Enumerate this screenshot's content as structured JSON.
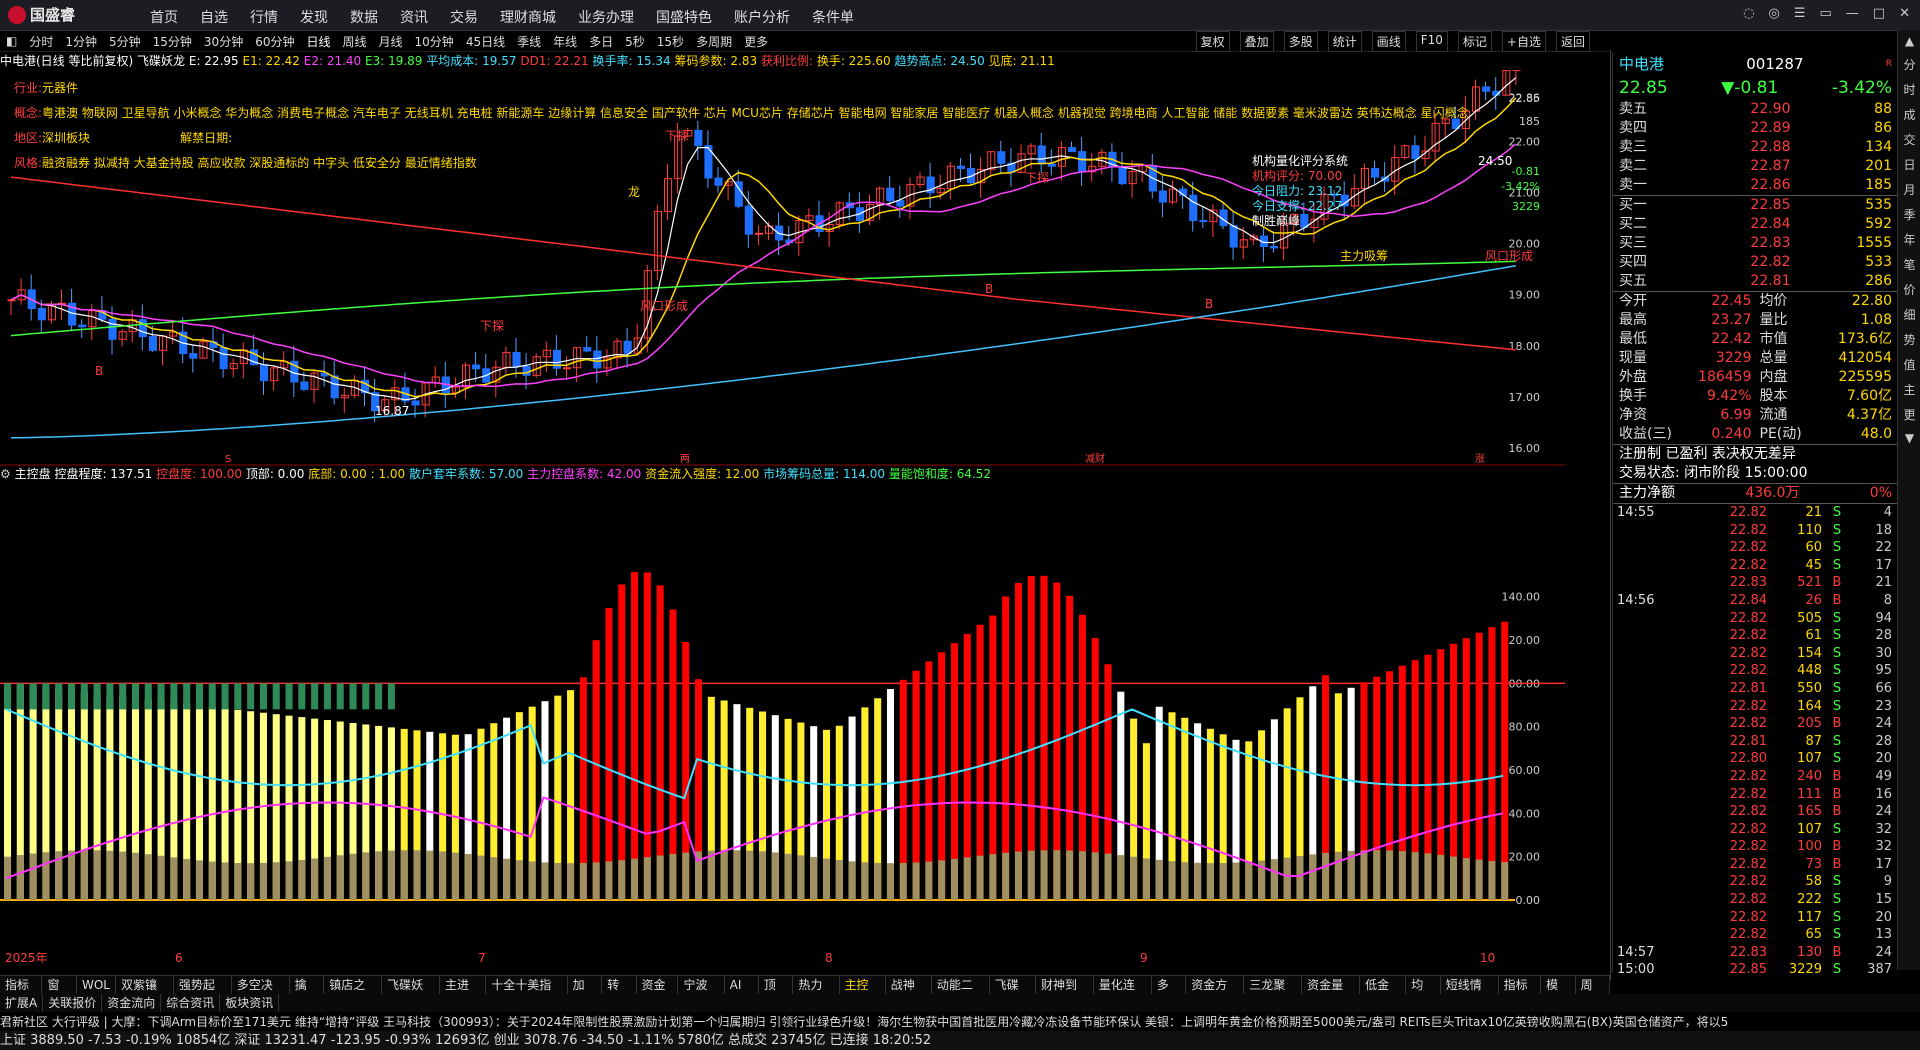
{
  "app": {
    "logo": "国盛睿",
    "menu": [
      "首页",
      "自选",
      "行情",
      "发现",
      "数据",
      "资讯",
      "交易",
      "理财商城",
      "业务办理",
      "国盛特色",
      "账户分析",
      "条件单"
    ],
    "window_buttons": [
      "□",
      "◎",
      "—",
      "□",
      "×"
    ]
  },
  "periods": {
    "items": [
      "分时",
      "1分钟",
      "5分钟",
      "15分钟",
      "30分钟",
      "60分钟",
      "日线",
      "周线",
      "月线",
      "10分钟",
      "45日线",
      "季线",
      "年线",
      "多日",
      "5秒",
      "15秒",
      "多周期",
      "更多"
    ],
    "active": "日线"
  },
  "tools": [
    "复权",
    "叠加",
    "多股",
    "统计",
    "画线",
    "F10",
    "标记",
    "+自选",
    "返回"
  ],
  "indicator_line": {
    "name": "中电港(日线 等比前复权)",
    "plugin": "飞碟妖龙",
    "e": "E: 22.95",
    "e1": "E1: 22.42",
    "e2": "E2: 21.40",
    "e3": "E3: 19.89",
    "avg": "平均成本: 19.57",
    "dd1": "DD1: 22.21",
    "turnover": "换手率: 15.34",
    "chip": "筹码参数: 2.83",
    "profit": "获利比例:",
    "hand": "换手: 225.60",
    "trend_high": "趋势高点: 24.50",
    "trend_low": "见底: 21.11"
  },
  "stock_info": {
    "industry_label": "行业:",
    "industry": "元器件",
    "concept_label": "概念:",
    "concepts": "粤港澳 物联网 卫星导航 小米概念 华为概念 消费电子概念 汽车电子 无线耳机 充电桩 新能源车 边缘计算 信息安全 国产软件 芯片 MCU芯片 存储芯片 智能电网 智能家居 智能医疗 机器人概念 机器视觉 跨境电商 人工智能 储能 数据要素 毫米波雷达 英伟达概念 星闪概念",
    "region_label": "地区:",
    "region": "深圳板块",
    "unlock_label": "解禁日期:",
    "style_label": "风格:",
    "style": "融资融券 拟减持 大基金持股 高应收款 深股通标的 中字头 低安全分 最近情绪指数"
  },
  "price_axis": [
    "22.86",
    "22.85",
    "22.00",
    "21.00",
    "20.00",
    "19.00",
    "18.00",
    "17.00",
    "16.00"
  ],
  "price_axis_right": [
    "185",
    "-0.81",
    "-3.42%",
    "3229"
  ],
  "annotations": {
    "quant_title": "机构量化评分系统",
    "quant_score": "机构评分: 70.00",
    "resist": "今日阻力: 23.12",
    "support": "今日支撑: 22.27",
    "peak": "制胜巅峰",
    "main_force": "主力吸筹",
    "wind": "风口形成",
    "down": "下探",
    "low_mark": "16.87",
    "high_mark": "24.50",
    "dragon": "龙",
    "b": "B"
  },
  "sub_indicator": {
    "name": "主控盘",
    "degree": "控盘程度: 137.51",
    "ctrl": "控盘度: 100.00",
    "top": "顶部: 0.00",
    "bottom": "底部: 0.00 : 1.00",
    "retail": "散户套牢系数: 57.00",
    "main": "主力控盘系数: 42.00",
    "inflow": "资金流入强度: 12.00",
    "market": "市场筹码总量: 114.00",
    "power": "量能饱和度: 64.52",
    "axis": [
      "140.00",
      "120.00",
      "100.00",
      "80.00",
      "60.00",
      "40.00",
      "20.00",
      "0.00"
    ]
  },
  "date_axis": [
    "2025年",
    "6",
    "7",
    "8",
    "9",
    "10"
  ],
  "date_axis_label": "日线",
  "quote": {
    "name": "中电港",
    "code": "001287",
    "flag": "R",
    "price": "22.85",
    "change": "▼-0.81",
    "pct": "-3.42%",
    "asks": [
      {
        "lbl": "卖五",
        "px": "22.90",
        "vol": "88"
      },
      {
        "lbl": "卖四",
        "px": "22.89",
        "vol": "86"
      },
      {
        "lbl": "卖三",
        "px": "22.88",
        "vol": "134"
      },
      {
        "lbl": "卖二",
        "px": "22.87",
        "vol": "201"
      },
      {
        "lbl": "卖一",
        "px": "22.86",
        "vol": "185"
      }
    ],
    "bids": [
      {
        "lbl": "买一",
        "px": "22.85",
        "vol": "535"
      },
      {
        "lbl": "买二",
        "px": "22.84",
        "vol": "592"
      },
      {
        "lbl": "买三",
        "px": "22.83",
        "vol": "1555"
      },
      {
        "lbl": "买四",
        "px": "22.82",
        "vol": "533"
      },
      {
        "lbl": "买五",
        "px": "22.81",
        "vol": "286"
      }
    ],
    "stats": [
      [
        "今开",
        "22.45",
        "均价",
        "22.80"
      ],
      [
        "最高",
        "23.27",
        "量比",
        "1.08"
      ],
      [
        "最低",
        "22.42",
        "市值",
        "173.6亿"
      ],
      [
        "现量",
        "3229",
        "总量",
        "412054"
      ],
      [
        "外盘",
        "186459",
        "内盘",
        "225595"
      ],
      [
        "换手",
        "9.42%",
        "股本",
        "7.60亿"
      ],
      [
        "净资",
        "6.99",
        "流通",
        "4.37亿"
      ],
      [
        "收益(三)",
        "0.240",
        "PE(动)",
        "48.0"
      ]
    ],
    "reg": "注册制 已盈利 表决权无差异",
    "trade_status": "交易状态: 闭市阶段 15:00:00",
    "net_label": "主力净额",
    "net_value": "436.0万",
    "net_pct": "0%"
  },
  "ticks": [
    [
      "14:55",
      "22.82",
      "21",
      "S",
      "4"
    ],
    [
      "",
      "22.82",
      "110",
      "S",
      "18"
    ],
    [
      "",
      "22.82",
      "60",
      "S",
      "22"
    ],
    [
      "",
      "22.82",
      "45",
      "S",
      "17"
    ],
    [
      "",
      "22.83",
      "521",
      "B",
      "21"
    ],
    [
      "14:56",
      "22.84",
      "26",
      "B",
      "8"
    ],
    [
      "",
      "22.82",
      "505",
      "S",
      "94"
    ],
    [
      "",
      "22.82",
      "61",
      "S",
      "28"
    ],
    [
      "",
      "22.82",
      "154",
      "S",
      "30"
    ],
    [
      "",
      "22.82",
      "448",
      "S",
      "95"
    ],
    [
      "",
      "22.81",
      "550",
      "S",
      "66"
    ],
    [
      "",
      "22.82",
      "164",
      "S",
      "23"
    ],
    [
      "",
      "22.82",
      "205",
      "B",
      "24"
    ],
    [
      "",
      "22.81",
      "87",
      "S",
      "28"
    ],
    [
      "",
      "22.80",
      "107",
      "S",
      "20"
    ],
    [
      "",
      "22.82",
      "240",
      "B",
      "49"
    ],
    [
      "",
      "22.82",
      "111",
      "B",
      "16"
    ],
    [
      "",
      "22.82",
      "165",
      "B",
      "24"
    ],
    [
      "",
      "22.82",
      "107",
      "S",
      "32"
    ],
    [
      "",
      "22.82",
      "100",
      "B",
      "32"
    ],
    [
      "",
      "22.82",
      "73",
      "B",
      "17"
    ],
    [
      "",
      "22.82",
      "58",
      "S",
      "9"
    ],
    [
      "",
      "22.82",
      "222",
      "S",
      "15"
    ],
    [
      "",
      "22.82",
      "117",
      "S",
      "20"
    ],
    [
      "",
      "22.82",
      "65",
      "S",
      "13"
    ],
    [
      "14:57",
      "22.83",
      "130",
      "B",
      "24"
    ],
    [
      "15:00",
      "22.85",
      "3229",
      "S",
      "387"
    ]
  ],
  "right_bar": [
    "分",
    "时",
    "成",
    "交",
    "日",
    "月",
    "季",
    "年",
    "笔",
    "价",
    "细",
    "势",
    "值",
    "主",
    "更"
  ],
  "tab_row1": [
    "指标A",
    "窗口",
    "WOL",
    "双紫镶龙",
    "强势起爆",
    "多空决策",
    "擒龙",
    "镇店之宝",
    "飞碟妖龙",
    "主进出",
    "十全十美指标",
    "加仓",
    "转点",
    "资金2",
    "宁波敢",
    "AI龙",
    "顶底",
    "热力图",
    "主控盘",
    "战神号",
    "动能二号",
    "飞碟妖",
    "财神到家",
    "量化连板",
    "多空",
    "资金方向",
    "三龙聚首",
    "资金量能",
    "低金叉",
    "均线",
    "短线情绪",
    "指标B",
    "模板",
    "周期"
  ],
  "tab_row1_active": "主控盘",
  "tab_row2": [
    "扩展A",
    "关联报价",
    "资金流向",
    "综合资讯",
    "板块资讯"
  ],
  "news": "君新社区   大行评级 | 大摩：下调Arm目标价至171美元 维持“增持”评级      王马科技（300993）：关于2024年限制性股票激励计划第一个归属期归      引领行业绿色升级！海尔生物获中国首批医用冷藏冷冻设备节能环保认      美银：上调明年黄金价格预期至5000美元/盎司      REITs巨头Tritax10亿英镑收购黑石(BX)英国仓储资产，将以5",
  "status_bar": "上证  3889.50   -7.53   -0.19%   10854亿  深证  13231.47  -123.95  -0.93%   12693亿  创业  3078.76   -34.50   -1.11%   5780亿   总成交   23745亿   已连接      18:20:52",
  "colors": {
    "up": "#ff3c3c",
    "down": "#00e0ff",
    "yellow": "#ffd800",
    "magenta": "#ff40ff",
    "bg": "#000000"
  }
}
